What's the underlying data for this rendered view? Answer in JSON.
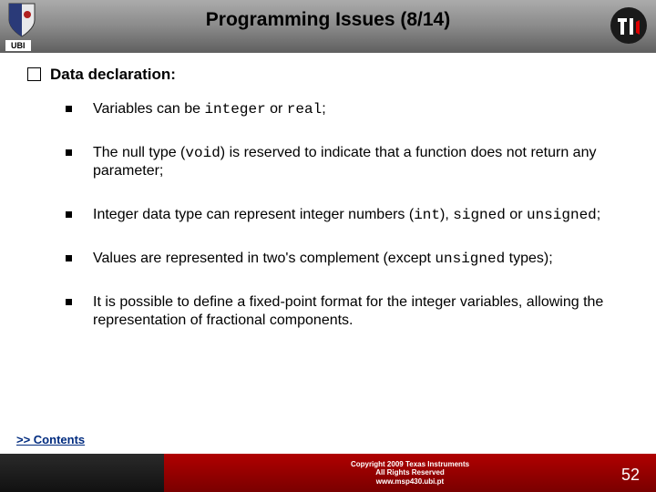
{
  "header": {
    "title": "Programming Issues (8/14)",
    "ubi_label": "UBI"
  },
  "main": {
    "headline": "Data declaration:",
    "items": [
      {
        "pre1": "Variables can be ",
        "code1": "integer",
        "mid1": " or ",
        "code2": "real",
        "post1": ";"
      },
      {
        "pre1": "The null type (",
        "code1": "void",
        "post1": ") is reserved to indicate that a function does not return any parameter;"
      },
      {
        "pre1": "Integer data type can represent integer numbers (",
        "code1": "int",
        "mid1": "), ",
        "code2": "signed",
        "mid2": " or ",
        "code3": "unsigned",
        "post1": ";"
      },
      {
        "pre1": "Values are represented in two's complement (except ",
        "code1": "unsigned",
        "post1": " types);"
      },
      {
        "pre1": "It is possible to define a fixed-point format for the integer variables, allowing the representation of fractional components."
      }
    ]
  },
  "link": {
    "contents": ">> Contents"
  },
  "footer": {
    "copyright1": "Copyright 2009 Texas Instruments",
    "copyright2": "All Rights Reserved",
    "url": "www.msp430.ubi.pt",
    "page": "52"
  }
}
